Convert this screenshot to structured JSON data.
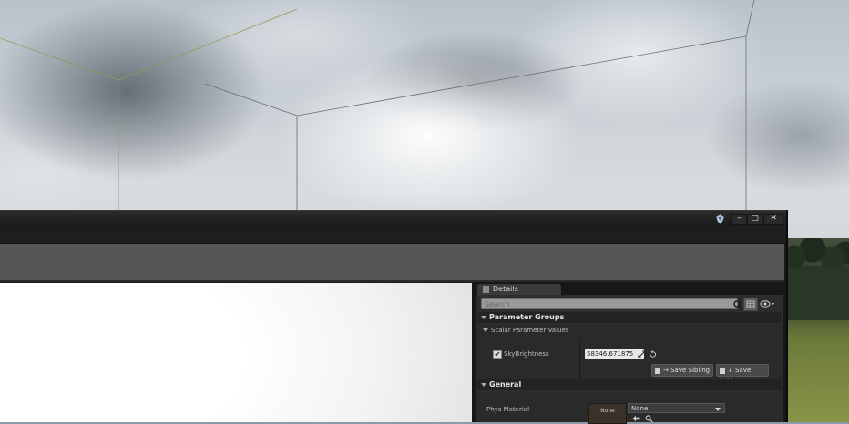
{
  "window": {
    "minimize_glyph": "–",
    "maximize_glyph": "□",
    "close_glyph": "✕"
  },
  "details": {
    "tab_label": "Details",
    "search_placeholder": "Search",
    "parameter_groups_header": "Parameter Groups",
    "scalar_group_label": "Scalar Parameter Values",
    "sky_brightness_label": "SkyBrightness",
    "sky_brightness_checked": true,
    "sky_brightness_value": "58346.671875",
    "save_sibling_label": "Save Sibling",
    "save_child_label": "Save Child",
    "general_header": "General",
    "phys_material_label": "Phys Material",
    "phys_material_thumb_text": "None",
    "phys_material_value": "None"
  },
  "icons": [
    "ue-logo-icon",
    "search-icon",
    "grid-view-icon",
    "eye-icon",
    "reset-icon",
    "value-drag-icon",
    "use-selected-arrow-icon",
    "browse-icon"
  ],
  "colors": {
    "panel_background": "#2d2d2d",
    "toolbar": "#555555",
    "title_bar": "#1c1c1c"
  }
}
